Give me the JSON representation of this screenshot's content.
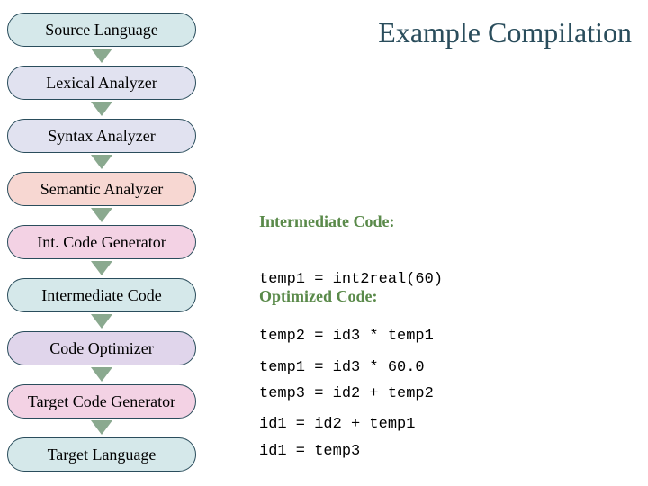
{
  "title": "Example Compilation",
  "stages": [
    {
      "label": "Source Language",
      "cls": "blue"
    },
    {
      "label": "Lexical Analyzer",
      "cls": "lav"
    },
    {
      "label": "Syntax Analyzer",
      "cls": "lav"
    },
    {
      "label": "Semantic Analyzer",
      "cls": "peach"
    },
    {
      "label": "Int. Code Generator",
      "cls": "pink"
    },
    {
      "label": "Intermediate Code",
      "cls": "blue"
    },
    {
      "label": "Code Optimizer",
      "cls": "lavdark"
    },
    {
      "label": "Target Code Generator",
      "cls": "pink"
    },
    {
      "label": "Target Language",
      "cls": "blue"
    }
  ],
  "intermediate": {
    "heading": "Intermediate Code:",
    "lines": [
      "temp1 = int2real(60)",
      "temp2 = id3 * temp1",
      "temp3 = id2 + temp2",
      "id1 = temp3"
    ]
  },
  "optimized": {
    "heading": "Optimized Code:",
    "lines": [
      "temp1 = id3 * 60.0",
      "id1 = id2 + temp1"
    ]
  }
}
